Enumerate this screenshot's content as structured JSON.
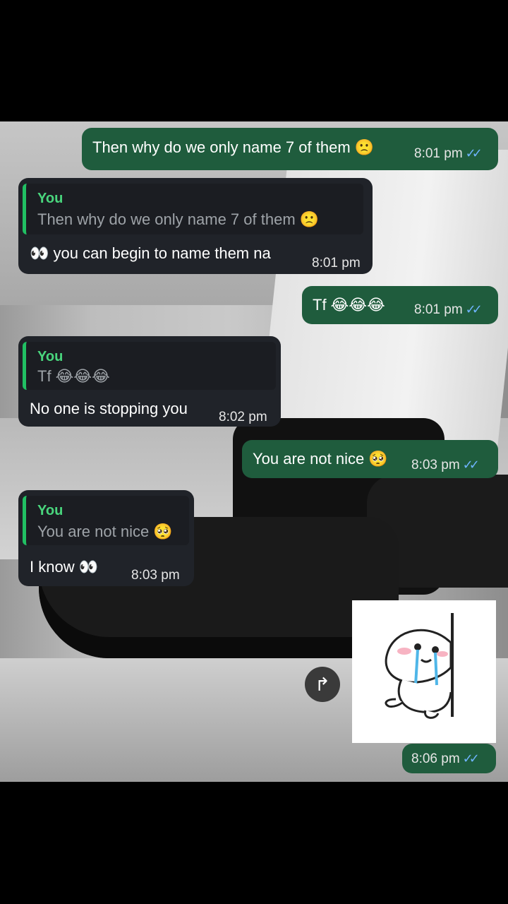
{
  "messages": [
    {
      "id": "m1",
      "direction": "out",
      "text": "Then why do we only name 7 of them 🙁",
      "time": "8:01 pm",
      "status": "read"
    },
    {
      "id": "m2",
      "direction": "in",
      "reply_author": "You",
      "reply_text": "Then why do we only name 7 of them 🙁",
      "text": "👀 you can begin to name them na",
      "time": "8:01 pm"
    },
    {
      "id": "m3",
      "direction": "out",
      "text": "Tf 😂😂😂",
      "time": "8:01 pm",
      "status": "read"
    },
    {
      "id": "m4",
      "direction": "in",
      "reply_author": "You",
      "reply_text": "Tf 😂😂😂",
      "text": "No one is stopping you",
      "time": "8:02 pm"
    },
    {
      "id": "m5",
      "direction": "out",
      "text": "You are not nice 🥺",
      "time": "8:03 pm",
      "status": "read"
    },
    {
      "id": "m6",
      "direction": "in",
      "reply_author": "You",
      "reply_text": "You are not nice 🥺",
      "text": "I know 👀",
      "time": "8:03 pm"
    },
    {
      "id": "m7",
      "direction": "out",
      "type": "sticker",
      "sticker": "crying-blob-behind-wall",
      "time": "8:06 pm",
      "status": "read"
    }
  ],
  "icons": {
    "read_receipt": "double-check-icon",
    "forward": "forward-icon"
  },
  "colors": {
    "outgoing_bubble": "#1f5c3d",
    "incoming_bubble": "#202329",
    "reply_accent": "#21c063",
    "read_tick": "#6fb4ff"
  }
}
